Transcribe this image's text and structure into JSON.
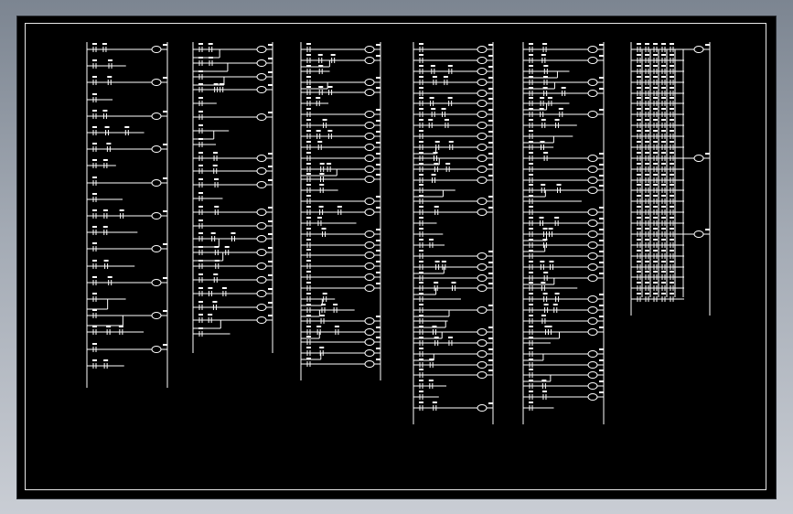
{
  "drawing": {
    "description_hidden": "",
    "line_color": "#ffffff",
    "background_color": "#000000",
    "frame_color": "#e8e8e8",
    "window_gradient": [
      "#7c8591",
      "#c9cdd4"
    ]
  },
  "ladder_columns": [
    {
      "id": "col-1",
      "rungs": 20,
      "style": "sparse"
    },
    {
      "id": "col-2",
      "rungs": 22,
      "style": "mixed"
    },
    {
      "id": "col-3",
      "rungs": 30,
      "style": "dense"
    },
    {
      "id": "col-4",
      "rungs": 34,
      "style": "dense"
    },
    {
      "id": "col-5",
      "rungs": 34,
      "style": "mixed"
    },
    {
      "id": "col-6",
      "rungs": 24,
      "style": "grid"
    }
  ]
}
